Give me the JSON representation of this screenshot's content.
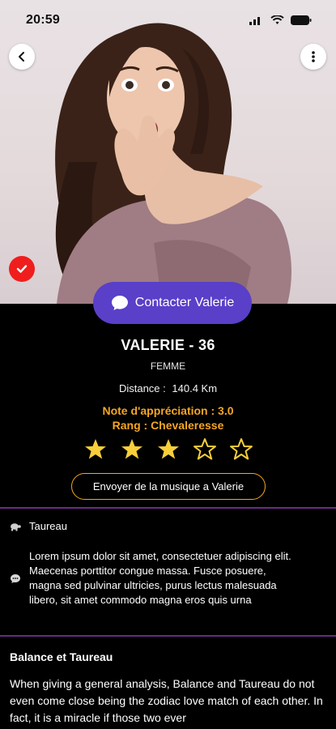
{
  "status_bar": {
    "time": "20:59"
  },
  "contact_button": {
    "label": "Contacter Valerie"
  },
  "profile": {
    "name": "VALERIE - 36",
    "gender": "FEMME",
    "distance_label": "Distance :",
    "distance_value": "140.4 Km",
    "rating_note": "Note d'appréciation : 3.0",
    "rank": "Rang : Chevaleresse",
    "stars": {
      "filled": 3,
      "total": 5
    }
  },
  "music_button": {
    "label": "Envoyer de la musique a Valerie"
  },
  "zodiac": {
    "sign": "Taureau"
  },
  "bio": {
    "text": "Lorem ipsum dolor sit amet, consectetuer adipiscing elit. Maecenas porttitor congue massa. Fusce posuere, magna sed pulvinar ultricies, purus lectus malesuada libero, sit amet commodo magna eros quis urna"
  },
  "compatibility": {
    "title": "Balance et Taureau",
    "text": "When giving a general analysis, Balance and Taureau do not even come close being the zodiac love match of each other. In fact, it is a miracle if those two ever"
  },
  "colors": {
    "accent_purple": "#5a3fc8",
    "rating_orange": "#f5a623",
    "star_yellow": "#f6cf3a",
    "verified_red": "#f01d1d",
    "divider_purple": "#6b2a86"
  },
  "icons": [
    "back-icon",
    "more-vertical-icon",
    "wifi-icon",
    "signal-icon",
    "battery-icon",
    "check-icon",
    "chat-bubble-icon",
    "turtle-icon",
    "comment-icon",
    "star-icon"
  ]
}
